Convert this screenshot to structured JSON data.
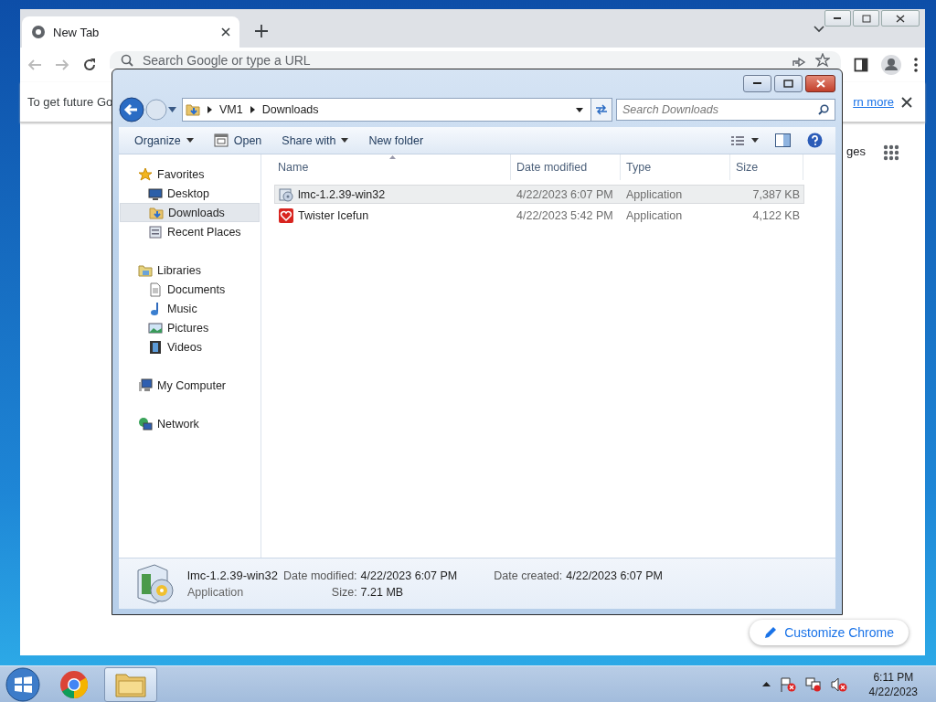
{
  "browser": {
    "tab": {
      "title": "New Tab",
      "selected": true
    },
    "omnibox": {
      "placeholder": "Search Google or type a URL"
    },
    "infobar": {
      "message": "To get future Go",
      "link": "rn more"
    },
    "shortcut_label": "ges",
    "customize_button": "Customize Chrome"
  },
  "explorer": {
    "breadcrumbs": [
      "VM1",
      "Downloads"
    ],
    "search": {
      "placeholder": "Search Downloads"
    },
    "toolbar": [
      {
        "label": "Organize",
        "kind": "menu"
      },
      {
        "label": "Open",
        "kind": "open"
      },
      {
        "label": "Share with",
        "kind": "menu"
      },
      {
        "label": "New folder",
        "kind": "plain"
      }
    ],
    "nav": [
      {
        "label": "Favorites",
        "kind": "star",
        "selected": false,
        "children": [
          {
            "label": "Desktop",
            "kind": "desktop",
            "selected": false
          },
          {
            "label": "Downloads",
            "kind": "download",
            "selected": true
          },
          {
            "label": "Recent Places",
            "kind": "recent",
            "selected": false
          }
        ]
      },
      {
        "label": "Libraries",
        "kind": "library",
        "selected": false,
        "children": [
          {
            "label": "Documents",
            "kind": "document",
            "selected": false
          },
          {
            "label": "Music",
            "kind": "music",
            "selected": false
          },
          {
            "label": "Pictures",
            "kind": "pictures",
            "selected": false
          },
          {
            "label": "Videos",
            "kind": "videos",
            "selected": false
          }
        ]
      },
      {
        "label": "My Computer",
        "kind": "computer",
        "selected": false
      },
      {
        "label": "Network",
        "kind": "network",
        "selected": false
      }
    ],
    "columns": [
      "Name",
      "Date modified",
      "Type",
      "Size"
    ],
    "files": [
      {
        "name": "lmc-1.2.39-win32",
        "date": "4/22/2023 6:07 PM",
        "type": "Application",
        "size": "7,387 KB",
        "kind": "installer",
        "selected": true
      },
      {
        "name": "Twister Icefun",
        "date": "4/22/2023 5:42 PM",
        "type": "Application",
        "size": "4,122 KB",
        "kind": "heart",
        "selected": false
      }
    ],
    "details": {
      "name": "lmc-1.2.39-win32",
      "type": "Application",
      "fields": [
        {
          "label": "Date modified:",
          "value": "4/22/2023 6:07 PM"
        },
        {
          "label": "Size:",
          "value": "7.21 MB"
        },
        {
          "label": "Date created:",
          "value": "4/22/2023 6:07 PM"
        }
      ]
    }
  },
  "taskbar": {
    "apps": [
      {
        "kind": "chrome",
        "selected": false
      },
      {
        "kind": "explorer",
        "selected": true
      }
    ],
    "time": "6:11 PM",
    "date": "4/22/2023"
  }
}
